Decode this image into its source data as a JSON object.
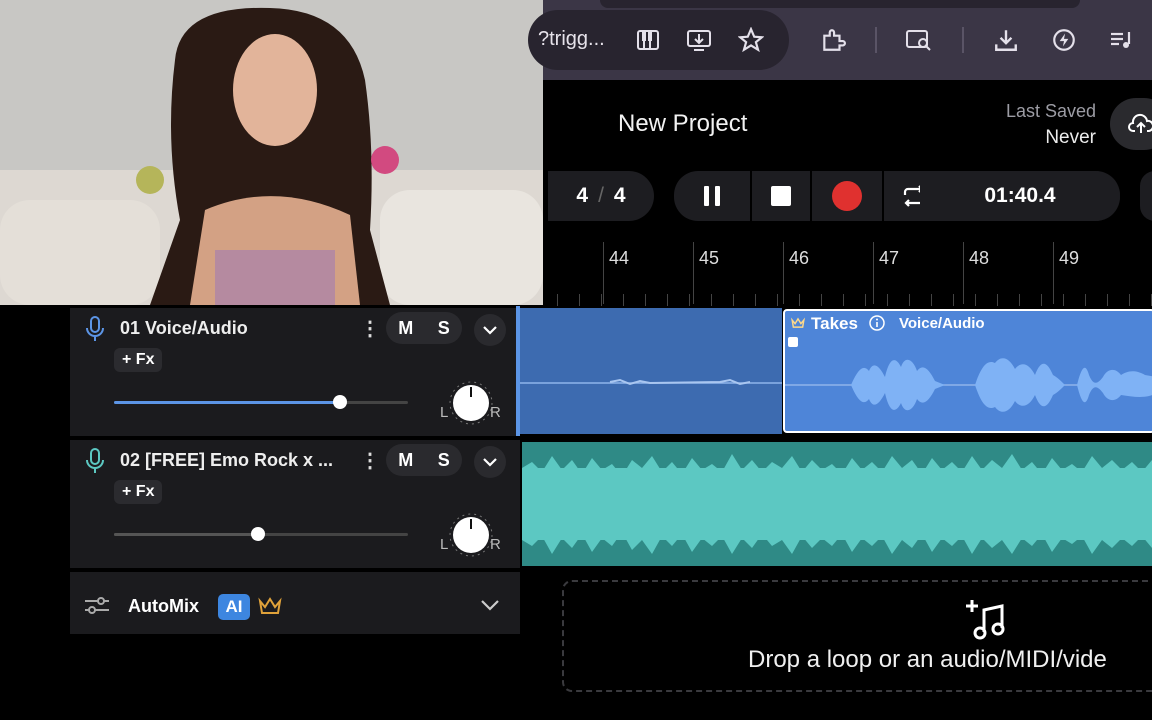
{
  "browser": {
    "omnibox_text": "?trigg...",
    "icons": [
      "piano-icon",
      "install-icon",
      "star-icon",
      "extensions-icon",
      "search-lens-icon",
      "download-icon",
      "bolt-icon",
      "playlist-icon"
    ]
  },
  "project": {
    "title": "New Project",
    "last_saved_label": "Last Saved",
    "last_saved_value": "Never"
  },
  "transport": {
    "time_sig_top": "4",
    "time_sig_sep": "/",
    "time_sig_bottom": "4",
    "time": "01:40.4",
    "record_color": "#e0312f"
  },
  "ruler": {
    "bars": [
      "44",
      "45",
      "46",
      "47",
      "48",
      "49"
    ]
  },
  "tracks": [
    {
      "name": "01  Voice/Audio",
      "mute": "M",
      "solo": "S",
      "fx": "+ Fx",
      "volume": 0.77,
      "pan_left": "L",
      "pan_right": "R",
      "color": "#4e85d8"
    },
    {
      "name": "02  [FREE] Emo Rock x ...",
      "mute": "M",
      "solo": "S",
      "fx": "+ Fx",
      "volume": 0.49,
      "pan_left": "L",
      "pan_right": "R",
      "color": "#5cc8c2"
    }
  ],
  "automix": {
    "label": "AutoMix",
    "badge": "AI"
  },
  "clips": {
    "takes_label": "Takes",
    "takes_sub": "Voice/Audio"
  },
  "dropzone": {
    "text": "Drop a loop or an audio/MIDI/vide"
  }
}
